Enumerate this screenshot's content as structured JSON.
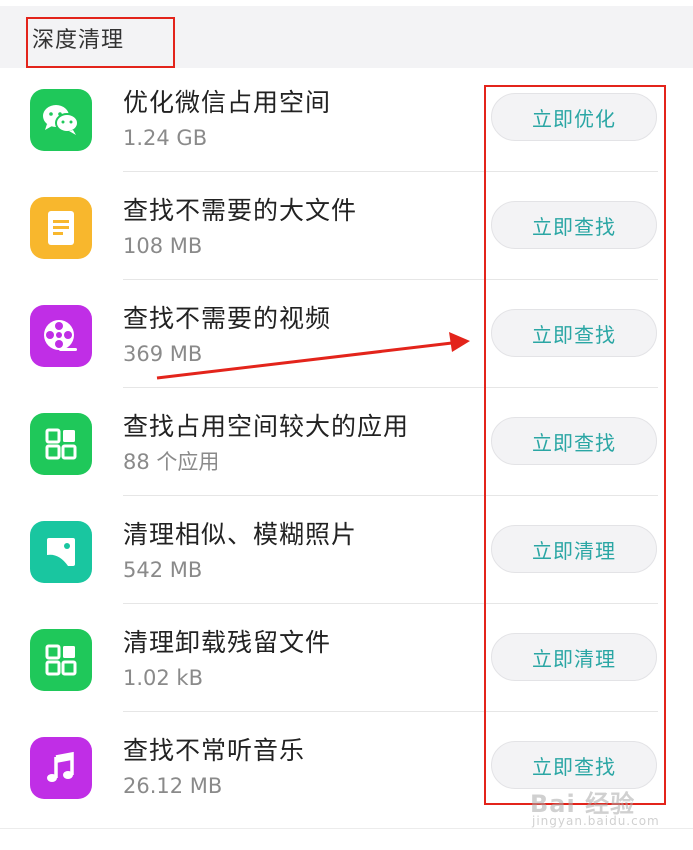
{
  "section": {
    "title": "深度清理"
  },
  "items": [
    {
      "icon": "wechat-icon",
      "color": "#1fc85a",
      "title": "优化微信占用空间",
      "sub": "1.24 GB",
      "action": "立即优化"
    },
    {
      "icon": "document-icon",
      "color": "#f8b72d",
      "title": "查找不需要的大文件",
      "sub": "108 MB",
      "action": "立即查找"
    },
    {
      "icon": "video-reel-icon",
      "color": "#c02ee6",
      "title": "查找不需要的视频",
      "sub": "369 MB",
      "action": "立即查找"
    },
    {
      "icon": "apps-grid-icon",
      "color": "#1fc85a",
      "title": "查找占用空间较大的应用",
      "sub": "88 个应用",
      "action": "立即查找"
    },
    {
      "icon": "image-icon",
      "color": "#19c6a0",
      "title": "清理相似、模糊照片",
      "sub": "542 MB",
      "action": "立即清理"
    },
    {
      "icon": "apps-grid-icon",
      "color": "#1fc85a",
      "title": "清理卸载残留文件",
      "sub": "1.02 kB",
      "action": "立即清理"
    },
    {
      "icon": "music-note-icon",
      "color": "#c02ee6",
      "title": "查找不常听音乐",
      "sub": "26.12 MB",
      "action": "立即查找"
    }
  ],
  "watermark": {
    "main": "Bai 经验",
    "sub": "jingyan.baidu.com"
  },
  "colors": {
    "accent": "#2aa6a4",
    "annotation": "#e3241b"
  }
}
